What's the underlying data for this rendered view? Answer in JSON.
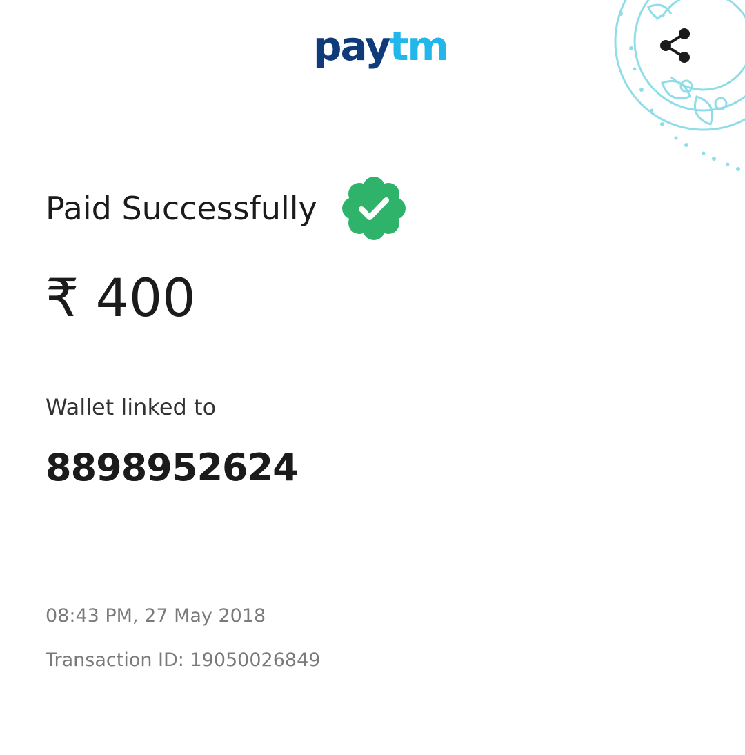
{
  "header": {
    "logo": {
      "part1": "pay",
      "part2": "tm"
    },
    "share_icon": "share-icon",
    "decoration": "mandala-pattern"
  },
  "receipt": {
    "status": "Paid Successfully",
    "status_icon": "verified-check-icon",
    "amount": "₹ 400",
    "wallet_label": "Wallet linked to",
    "wallet_number": "8898952624",
    "datetime": "08:43 PM, 27 May 2018",
    "transaction_id": "Transaction ID: 19050026849"
  },
  "colors": {
    "brand_dark": "#0f3b7a",
    "brand_light": "#21b7ea",
    "success": "#2fb36b",
    "mandala": "#7fd8e6"
  }
}
